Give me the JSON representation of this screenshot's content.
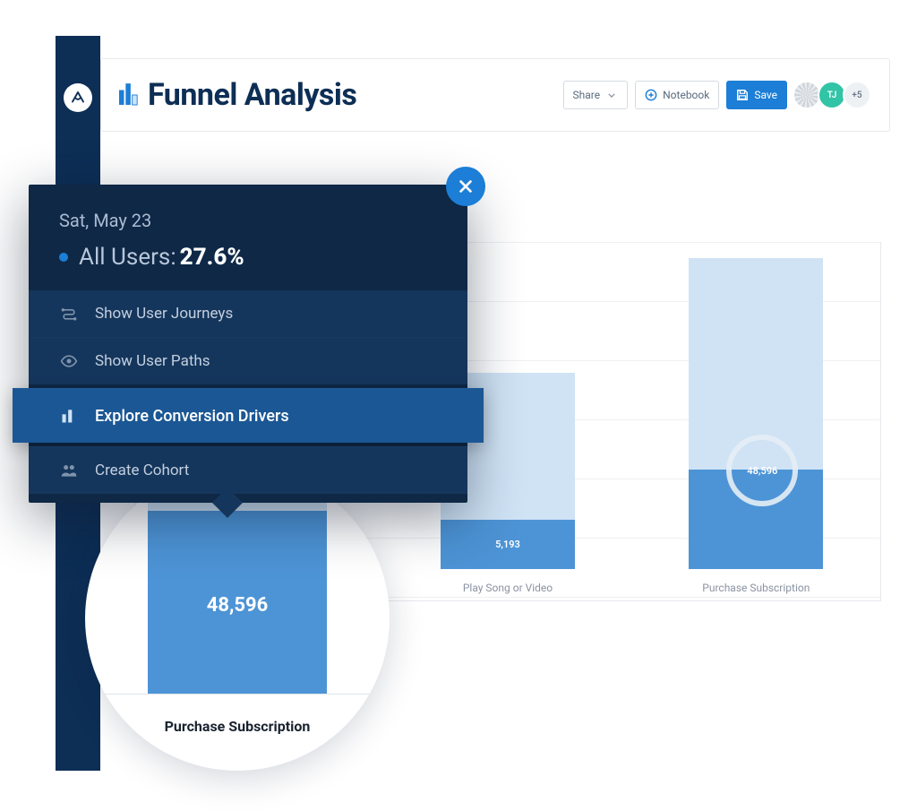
{
  "header": {
    "title": "Funnel Analysis",
    "share_label": "Share",
    "notebook_label": "Notebook",
    "save_label": "Save",
    "avatar2_initials": "TJ",
    "overflow_count": "+5"
  },
  "popover": {
    "date": "Sat, May 23",
    "segment_label": "All Users:",
    "segment_value": "27.6%",
    "menu": {
      "journeys": "Show User Journeys",
      "paths": "Show User Paths",
      "drivers": "Explore Conversion Drivers",
      "cohort": "Create Cohort"
    }
  },
  "zoom": {
    "value": "48,596",
    "label": "Purchase Subscription"
  },
  "chart_data": {
    "type": "bar",
    "categories": [
      "Play Song or Video",
      "Purchase Subscription"
    ],
    "series": [
      {
        "name": "All Users funnel",
        "values": [
          null,
          48596
        ]
      }
    ],
    "annotation_labels": [
      "5,193",
      "48,596"
    ],
    "xlabel": "",
    "ylabel": "",
    "note": "First step bar ~full height; second step dark portion ~27.6% of first"
  },
  "chart": {
    "col2": {
      "label": "Play Song or Video",
      "dark_label": "5,193"
    },
    "col3": {
      "label": "Purchase Subscription",
      "ring_label": "48,596"
    }
  },
  "colors": {
    "brand_dark": "#0d2e55",
    "primary": "#1c7ed6",
    "bar_light": "#cfe3f5",
    "bar_dark": "#4d94d6"
  }
}
